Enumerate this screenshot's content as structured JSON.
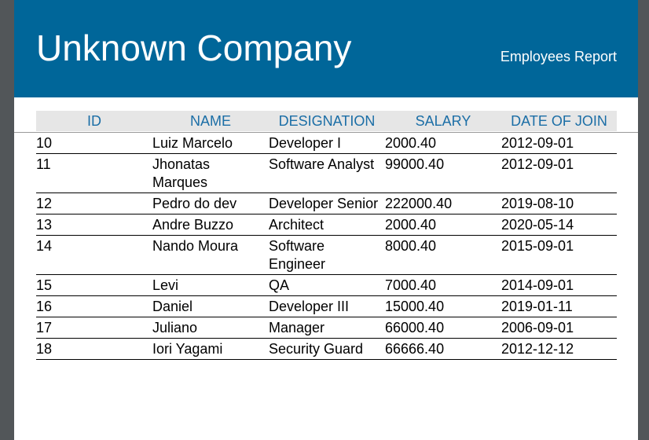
{
  "header": {
    "company": "Unknown Company",
    "report_title": "Employees Report"
  },
  "table": {
    "columns": [
      "ID",
      "NAME",
      "DESIGNATION",
      "SALARY",
      "DATE OF JOIN"
    ],
    "rows": [
      {
        "id": "10",
        "name": "Luiz Marcelo",
        "designation": "Developer I",
        "salary": "2000.40",
        "date_of_join": "2012-09-01"
      },
      {
        "id": "11",
        "name": "Jhonatas Marques",
        "designation": "Software Analyst",
        "salary": "99000.40",
        "date_of_join": "2012-09-01"
      },
      {
        "id": "12",
        "name": "Pedro do dev",
        "designation": "Developer Senior",
        "salary": "222000.40",
        "date_of_join": "2019-08-10"
      },
      {
        "id": "13",
        "name": "Andre Buzzo",
        "designation": "Architect",
        "salary": "2000.40",
        "date_of_join": "2020-05-14"
      },
      {
        "id": "14",
        "name": "Nando Moura",
        "designation": "Software Engineer",
        "salary": "8000.40",
        "date_of_join": "2015-09-01"
      },
      {
        "id": "15",
        "name": "Levi",
        "designation": "QA",
        "salary": "7000.40",
        "date_of_join": "2014-09-01"
      },
      {
        "id": "16",
        "name": "Daniel",
        "designation": "Developer III",
        "salary": "15000.40",
        "date_of_join": "2019-01-11"
      },
      {
        "id": "17",
        "name": "Juliano",
        "designation": "Manager",
        "salary": "66000.40",
        "date_of_join": "2006-09-01"
      },
      {
        "id": "18",
        "name": "Iori Yagami",
        "designation": "Security Guard",
        "salary": "66666.40",
        "date_of_join": "2012-12-12"
      }
    ]
  }
}
